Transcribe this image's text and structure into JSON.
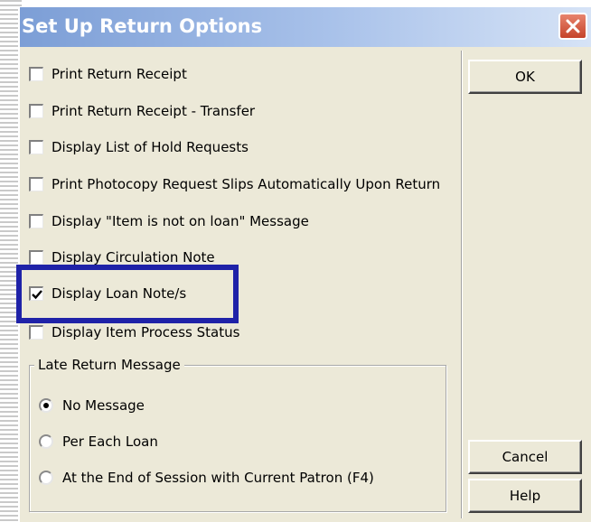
{
  "dialog": {
    "title": "Set Up Return Options",
    "close_icon": "close-icon"
  },
  "checkboxes": [
    {
      "label": "Print Return Receipt",
      "checked": false
    },
    {
      "label": "Print Return Receipt - Transfer",
      "checked": false
    },
    {
      "label": "Display List of Hold Requests",
      "checked": false
    },
    {
      "label": "Print Photocopy Request Slips Automatically Upon Return",
      "checked": false
    },
    {
      "label": "Display \"Item is not on loan\" Message",
      "checked": false
    },
    {
      "label": "Display Circulation Note",
      "checked": false
    },
    {
      "label": "Display Loan Note/s",
      "checked": true
    },
    {
      "label": "Display Item Process Status",
      "checked": false
    }
  ],
  "late_return": {
    "legend": "Late Return Message",
    "options": [
      {
        "label": "No Message",
        "selected": true
      },
      {
        "label": "Per Each Loan",
        "selected": false
      },
      {
        "label": "At the End of Session with Current Patron (F4)",
        "selected": false
      }
    ]
  },
  "buttons": {
    "ok": "OK",
    "cancel": "Cancel",
    "help": "Help"
  },
  "colors": {
    "highlight": "#1f22a8",
    "dialog_bg": "#ece9d8",
    "close_button": "#c5432a"
  }
}
